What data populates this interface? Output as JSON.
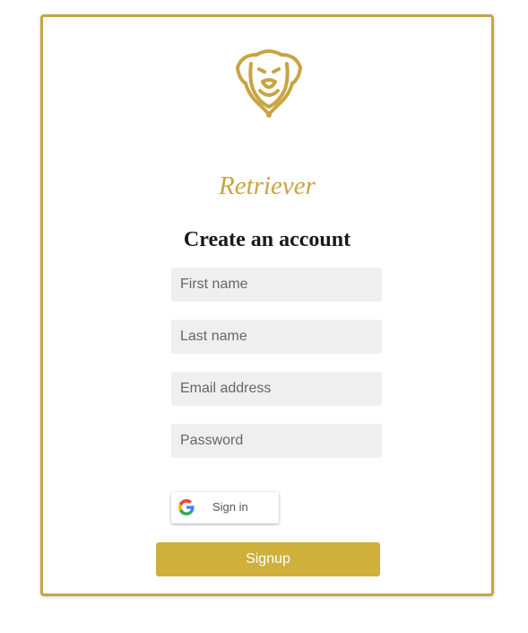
{
  "brand": {
    "name": "Retriever",
    "color": "#c8a442",
    "logo_icon": "retriever-dog-icon"
  },
  "form": {
    "heading": "Create an account",
    "fields": [
      {
        "name": "first-name",
        "placeholder": "First name",
        "value": ""
      },
      {
        "name": "last-name",
        "placeholder": "Last name",
        "value": ""
      },
      {
        "name": "email",
        "placeholder": "Email address",
        "value": ""
      },
      {
        "name": "password",
        "placeholder": "Password",
        "value": ""
      }
    ],
    "google_signin": {
      "label": "Sign in",
      "icon": "google-icon"
    },
    "submit_label": "Signup",
    "submit_color": "#ceb03a"
  }
}
